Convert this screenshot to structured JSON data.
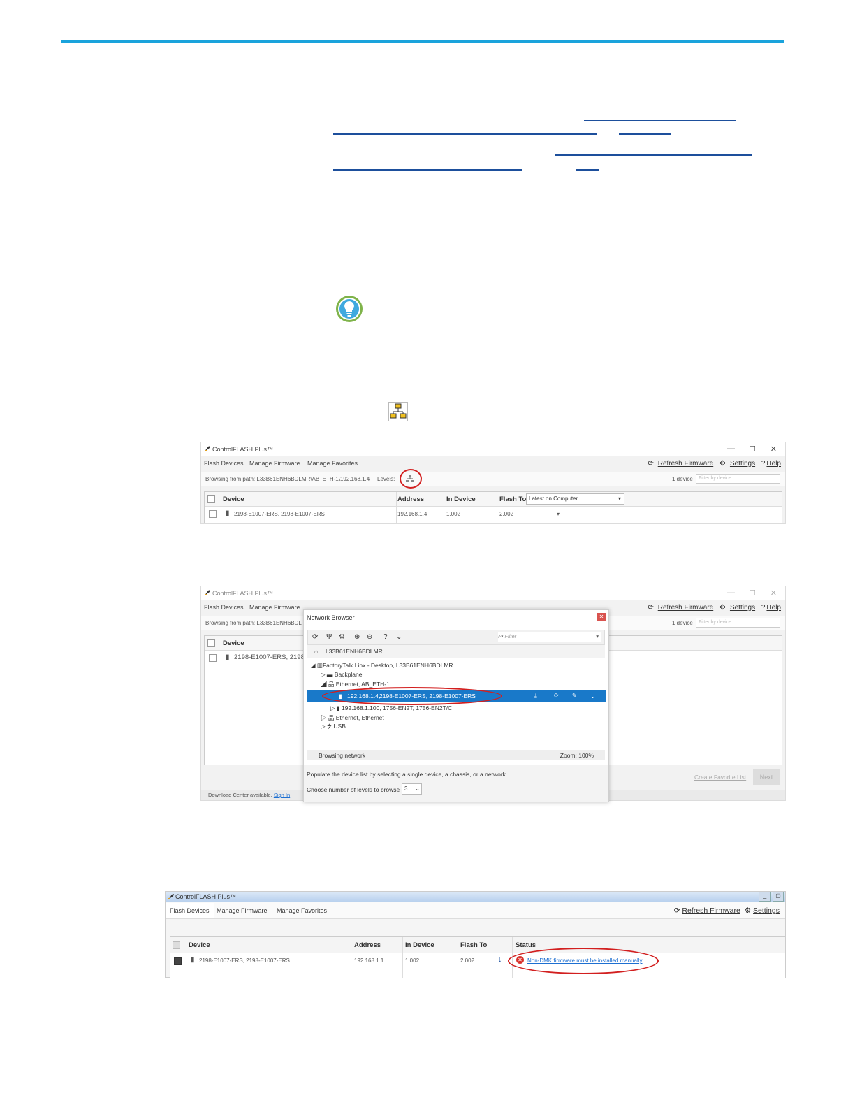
{
  "window1": {
    "app_title": "ControlFLASH Plus™",
    "tabs": [
      "Flash Devices",
      "Manage Firmware",
      "Manage Favorites"
    ],
    "refresh_firmware": "Refresh Firmware",
    "settings": "Settings",
    "help_mark": "?",
    "help": "Help",
    "browse_path": "Browsing from path: L33B61ENH6BDLMR\\AB_ETH-1\\192.168.1.4",
    "levels_label": "Levels:",
    "device_count": "1 device",
    "filter_placeholder": "Filter by device",
    "columns": {
      "device": "Device",
      "address": "Address",
      "in_device": "In Device",
      "flash_to": "Flash To"
    },
    "flash_to_header_select": "Latest on Computer",
    "row": {
      "device": "2198-E1007-ERS, 2198-E1007-ERS",
      "address": "192.168.1.4",
      "in_device": "1.002",
      "flash_to": "2.002"
    }
  },
  "window2": {
    "app_title": "ControlFLASH Plus™",
    "tabs": [
      "Flash Devices",
      "Manage Firmware"
    ],
    "refresh_firmware": "Refresh Firmware",
    "settings": "Settings",
    "help_mark": "?",
    "help": "Help",
    "browse_path": "Browsing from path: L33B61ENH6BDL",
    "device_count": "1 device",
    "filter_placeholder": "Filter by device",
    "column_device": "Device",
    "row_device": "2198-E1007-ERS, 2198-E",
    "create_favorite": "Create Favorite List",
    "next": "Next",
    "download_center": "Download Center available.",
    "sign_in": "Sign In",
    "network_browser": {
      "title": "Network Browser",
      "filter_placeholder": "Filter",
      "root": "L33B61ENH6BDLMR",
      "tree": {
        "linx": "FactoryTalk Linx - Desktop, L33B61ENH6BDLMR",
        "backplane": "Backplane",
        "ethernet_ab": "Ethernet, AB_ETH-1",
        "selected_ip": "192.168.1.4,",
        "selected_device": "2198-E1007-ERS, 2198-E1007-ERS",
        "other_device": "192.168.1.100, 1756-EN2T, 1756-EN2T/C",
        "ethernet": "Ethernet, Ethernet",
        "usb": "USB"
      },
      "status": "Browsing network",
      "zoom": "Zoom: 100%",
      "populate_text": "Populate the device list by selecting a single device, a chassis, or a network.",
      "levels_text": "Choose number of levels to browse",
      "levels_value": "3"
    }
  },
  "window3": {
    "app_title": "ControlFLASH Plus™",
    "tabs": [
      "Flash Devices",
      "Manage Firmware",
      "Manage Favorites"
    ],
    "refresh_firmware": "Refresh Firmware",
    "settings": "Settings",
    "columns": {
      "device": "Device",
      "address": "Address",
      "in_device": "In Device",
      "flash_to": "Flash To",
      "status": "Status"
    },
    "row": {
      "device": "2198-E1007-ERS, 2198-E1007-ERS",
      "address": "192.168.1.1",
      "in_device": "1.002",
      "flash_to": "2.002",
      "status": "Non-DMK firmware must be installed manually"
    }
  },
  "colors": {
    "accent": "#1aa3dc",
    "link": "#1d4f9c",
    "highlight": "#d21f1f",
    "selection": "#1979c9"
  }
}
